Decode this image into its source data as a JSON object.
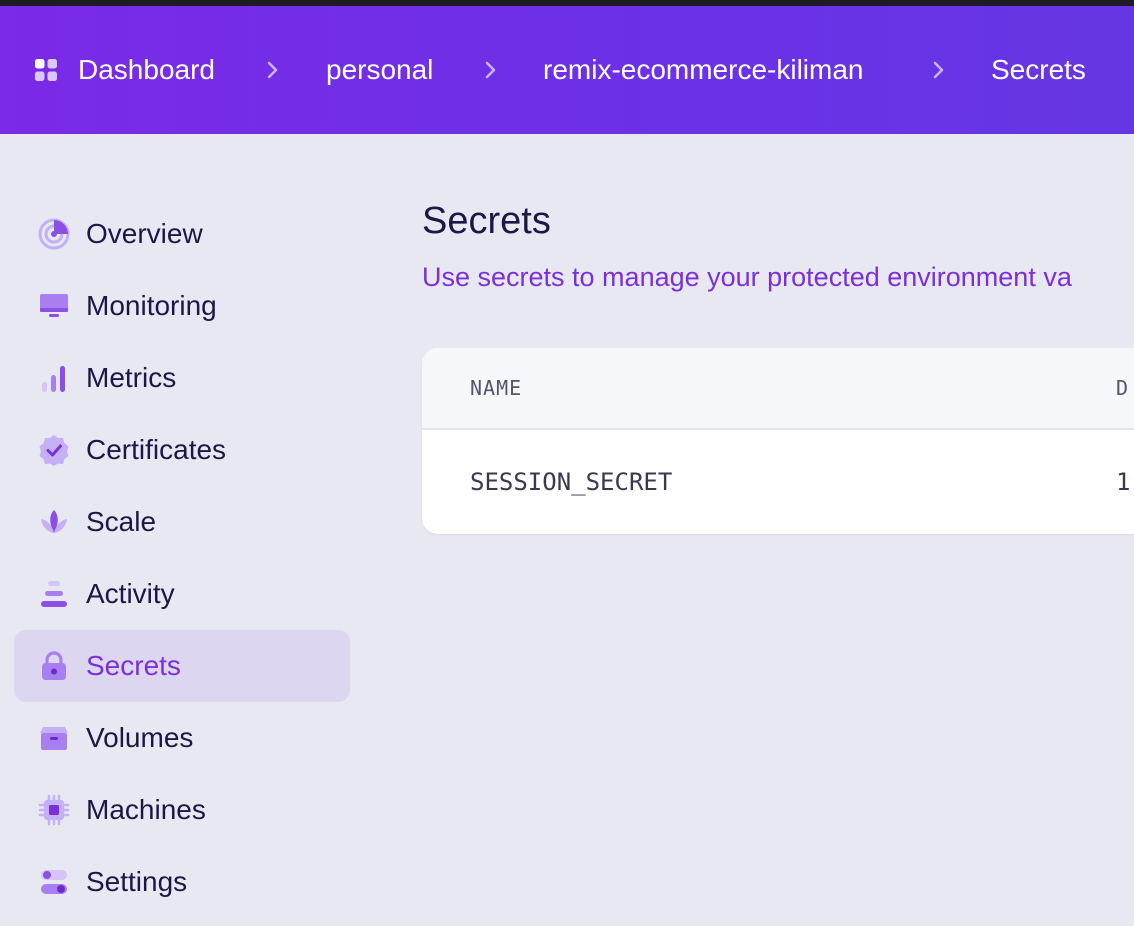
{
  "breadcrumb": {
    "items": [
      {
        "label": "Dashboard",
        "icon": "grid-icon"
      },
      {
        "label": "personal"
      },
      {
        "label": "remix-ecommerce-kiliman"
      },
      {
        "label": "Secrets"
      }
    ],
    "separator_icon": "chevron-right-icon"
  },
  "sidebar": {
    "items": [
      {
        "label": "Overview",
        "icon": "radar-icon",
        "active": false
      },
      {
        "label": "Monitoring",
        "icon": "monitor-icon",
        "active": false
      },
      {
        "label": "Metrics",
        "icon": "bar-chart-icon",
        "active": false
      },
      {
        "label": "Certificates",
        "icon": "badge-check-icon",
        "active": false
      },
      {
        "label": "Scale",
        "icon": "sprout-icon",
        "active": false
      },
      {
        "label": "Activity",
        "icon": "stack-icon",
        "active": false
      },
      {
        "label": "Secrets",
        "icon": "lock-icon",
        "active": true
      },
      {
        "label": "Volumes",
        "icon": "archive-box-icon",
        "active": false
      },
      {
        "label": "Machines",
        "icon": "cpu-chip-icon",
        "active": false
      },
      {
        "label": "Settings",
        "icon": "toggles-icon",
        "active": false
      }
    ]
  },
  "main": {
    "title": "Secrets",
    "subtitle": "Use secrets to manage your protected environment va",
    "table": {
      "columns": [
        "NAME",
        "D"
      ],
      "rows": [
        {
          "name": "SESSION_SECRET",
          "second": "1"
        }
      ]
    }
  },
  "colors": {
    "header_gradient_start": "#7b2ae7",
    "header_gradient_end": "#6636e4",
    "accent": "#7b2fd9",
    "background": "#e8e8f3",
    "text_dark": "#1c1745",
    "active_item_bg": "#dcd6f1"
  }
}
